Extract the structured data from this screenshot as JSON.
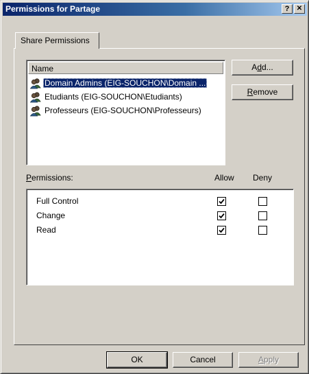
{
  "window": {
    "title": "Permissions for Partage",
    "help_label": "?",
    "close_label": "✕"
  },
  "tabs": [
    {
      "label": "Share Permissions",
      "active": true
    }
  ],
  "users_list": {
    "column_header": "Name",
    "items": [
      {
        "label": "Domain Admins (EIG-SOUCHON\\Domain ...",
        "icon": "group-icon",
        "selected": true
      },
      {
        "label": "Etudiants (EIG-SOUCHON\\Etudiants)",
        "icon": "group-icon",
        "selected": false
      },
      {
        "label": "Professeurs (EIG-SOUCHON\\Professeurs)",
        "icon": "group-icon",
        "selected": false
      }
    ]
  },
  "buttons": {
    "add": {
      "pre": "A",
      "ul": "d",
      "post": "d..."
    },
    "remove": {
      "pre": "",
      "ul": "R",
      "post": "emove"
    },
    "ok": "OK",
    "cancel": "Cancel",
    "apply": {
      "pre": "",
      "ul": "A",
      "post": "pply",
      "disabled": true
    }
  },
  "permissions": {
    "label_ul": "P",
    "label_rest": "ermissions:",
    "allow_header": "Allow",
    "deny_header": "Deny",
    "rows": [
      {
        "name": "Full Control",
        "allow": true,
        "deny": false
      },
      {
        "name": "Change",
        "allow": true,
        "deny": false
      },
      {
        "name": "Read",
        "allow": true,
        "deny": false
      }
    ]
  },
  "colors": {
    "titlebar_start": "#0a246a",
    "titlebar_end": "#a6caf0",
    "face": "#d4d0c8",
    "selection": "#0a246a"
  }
}
